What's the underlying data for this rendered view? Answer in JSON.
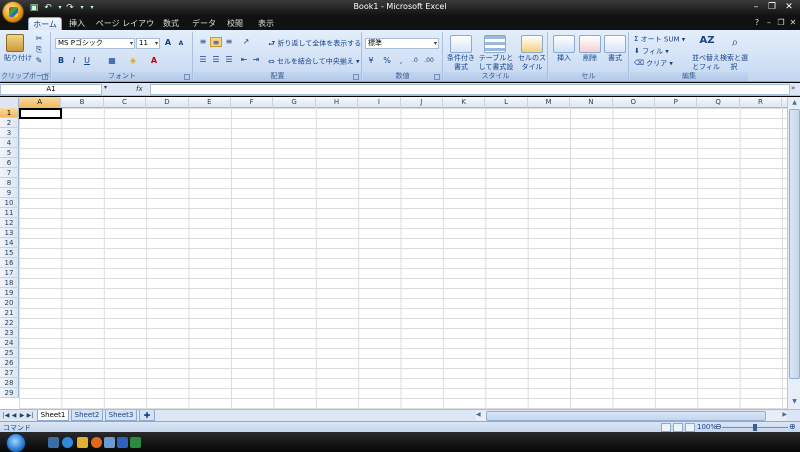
{
  "window": {
    "title": "Book1 - Microsoft Excel"
  },
  "quick_access": {
    "save_icon": "save-icon",
    "undo_icon": "undo-icon",
    "redo_icon": "redo-icon"
  },
  "window_controls": {
    "minimize": "–",
    "restore": "❐",
    "close": "✕"
  },
  "tabs": [
    {
      "label": "ホーム"
    },
    {
      "label": "挿入"
    },
    {
      "label": "ページ レイアウト"
    },
    {
      "label": "数式"
    },
    {
      "label": "データ"
    },
    {
      "label": "校閲"
    },
    {
      "label": "表示"
    }
  ],
  "ribbon": {
    "clipboard": {
      "paste": "貼り付け",
      "label": "クリップボード"
    },
    "font": {
      "name": "MS Pゴシック",
      "size": "11",
      "label": "フォント"
    },
    "alignment": {
      "wrap": "折り返して全体を表示する",
      "merge": "セルを結合して中央揃え",
      "label": "配置"
    },
    "number": {
      "format": "標準",
      "label": "数値"
    },
    "styles": {
      "conditional": "条件付き書式",
      "table": "テーブルとして書式設定",
      "cellstyle": "セルのスタイル",
      "label": "スタイル"
    },
    "cells": {
      "insert": "挿入",
      "delete": "削除",
      "format": "書式",
      "label": "セル"
    },
    "editing": {
      "autosum": "オート SUM",
      "fill": "フィル",
      "clear": "クリア",
      "sort": "並べ替えとフィルタ",
      "find": "検索と選択",
      "label": "編集"
    }
  },
  "formula_bar": {
    "name_box": "A1",
    "fx": "fx",
    "value": ""
  },
  "columns": [
    "A",
    "B",
    "C",
    "D",
    "E",
    "F",
    "G",
    "H",
    "I",
    "J",
    "K",
    "L",
    "M",
    "N",
    "O",
    "P",
    "Q",
    "R"
  ],
  "rows": [
    "1",
    "2",
    "3",
    "4",
    "5",
    "6",
    "7",
    "8",
    "9",
    "10",
    "11",
    "12",
    "13",
    "14",
    "15",
    "16",
    "17",
    "18",
    "19",
    "20",
    "21",
    "22",
    "23",
    "24",
    "25",
    "26",
    "27",
    "28",
    "29"
  ],
  "sheets": [
    {
      "label": "Sheet1"
    },
    {
      "label": "Sheet2"
    },
    {
      "label": "Sheet3"
    }
  ],
  "status": {
    "mode": "コマンド",
    "zoom": "100%"
  }
}
